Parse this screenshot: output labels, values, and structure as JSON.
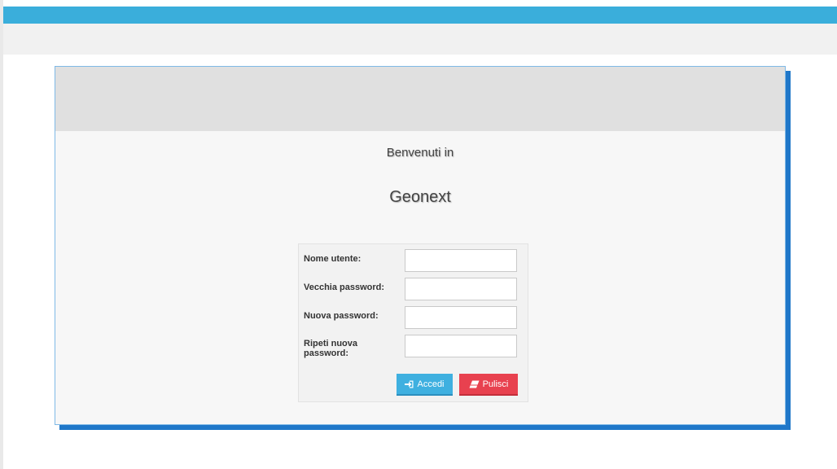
{
  "colors": {
    "top_bar": "#3aaedb",
    "card_shadow": "#1f77c9",
    "accedi_button": "#3fb0e0",
    "pulisci_button": "#e8414f"
  },
  "welcome": {
    "line1": "Benvenuti in",
    "app_name": "Geonext"
  },
  "form": {
    "username_label": "Nome utente:",
    "old_password_label": "Vecchia password:",
    "new_password_label": "Nuova password:",
    "repeat_password_label_line1": "Ripeti nuova",
    "repeat_password_label_line2": "password:",
    "username_value": "",
    "old_password_value": "",
    "new_password_value": "",
    "repeat_password_value": ""
  },
  "buttons": {
    "accedi_label": "Accedi",
    "accedi_icon": "sign-in-icon",
    "pulisci_label": "Pulisci",
    "pulisci_icon": "eraser-icon"
  }
}
